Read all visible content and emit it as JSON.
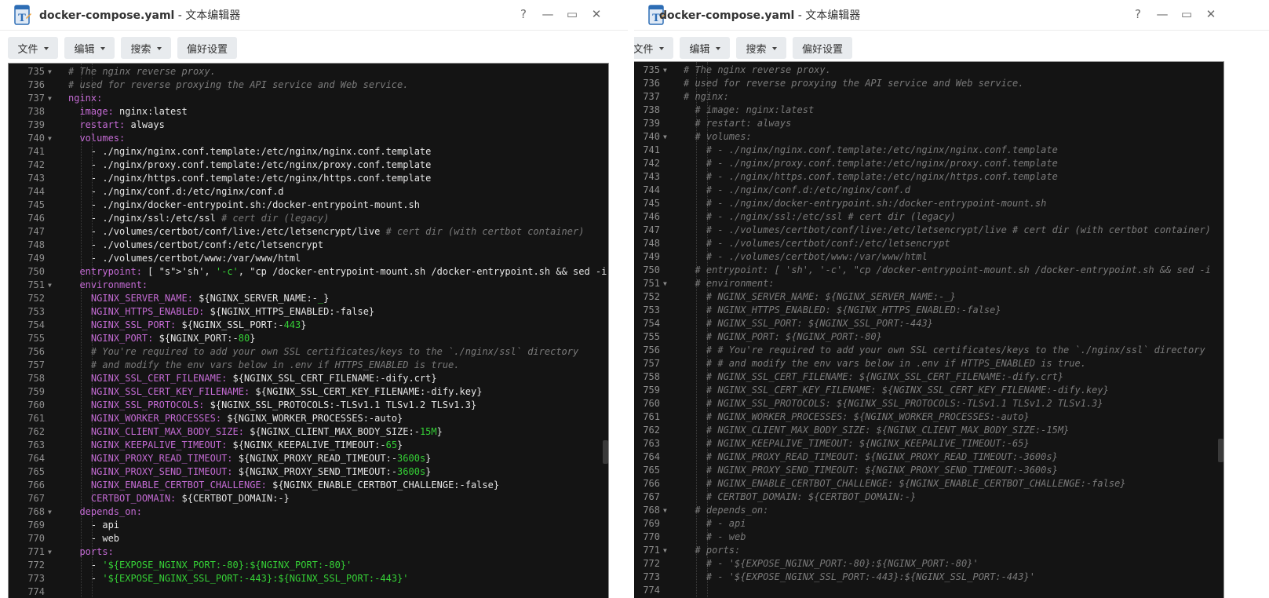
{
  "left": {
    "title": {
      "filename": "docker-compose.yaml",
      "suffix": " - 文本编辑器"
    },
    "menus": [
      {
        "label": "文件",
        "dropdown": true
      },
      {
        "label": "编辑",
        "dropdown": true
      },
      {
        "label": "搜索",
        "dropdown": true
      },
      {
        "label": "偏好设置",
        "dropdown": false
      }
    ],
    "lines": [
      {
        "n": "735",
        "fold": true,
        "t": "# The nginx reverse proxy."
      },
      {
        "n": "736",
        "t": "# used for reverse proxying the API service and Web service."
      },
      {
        "n": "737",
        "fold": true,
        "t": "nginx:"
      },
      {
        "n": "738",
        "t": "  image: nginx:latest"
      },
      {
        "n": "739",
        "t": "  restart: always"
      },
      {
        "n": "740",
        "fold": true,
        "t": "  volumes:"
      },
      {
        "n": "741",
        "t": "    - ./nginx/nginx.conf.template:/etc/nginx/nginx.conf.template"
      },
      {
        "n": "742",
        "t": "    - ./nginx/proxy.conf.template:/etc/nginx/proxy.conf.template"
      },
      {
        "n": "743",
        "t": "    - ./nginx/https.conf.template:/etc/nginx/https.conf.template"
      },
      {
        "n": "744",
        "t": "    - ./nginx/conf.d:/etc/nginx/conf.d"
      },
      {
        "n": "745",
        "t": "    - ./nginx/docker-entrypoint.sh:/docker-entrypoint-mount.sh"
      },
      {
        "n": "746",
        "t": "    - ./nginx/ssl:/etc/ssl # cert dir (legacy)"
      },
      {
        "n": "747",
        "t": "    - ./volumes/certbot/conf/live:/etc/letsencrypt/live # cert dir (with certbot container)"
      },
      {
        "n": "748",
        "t": "    - ./volumes/certbot/conf:/etc/letsencrypt"
      },
      {
        "n": "749",
        "t": "    - ./volumes/certbot/www:/var/www/html"
      },
      {
        "n": "750",
        "t": "  entrypoint: [ 'sh', '-c', \"cp /docker-entrypoint-mount.sh /docker-entrypoint.sh && sed -i"
      },
      {
        "n": "751",
        "fold": true,
        "t": "  environment:"
      },
      {
        "n": "752",
        "t": "    NGINX_SERVER_NAME: ${NGINX_SERVER_NAME:-_}"
      },
      {
        "n": "753",
        "t": "    NGINX_HTTPS_ENABLED: ${NGINX_HTTPS_ENABLED:-false}"
      },
      {
        "n": "754",
        "t": "    NGINX_SSL_PORT: ${NGINX_SSL_PORT:-443}"
      },
      {
        "n": "755",
        "t": "    NGINX_PORT: ${NGINX_PORT:-80}"
      },
      {
        "n": "756",
        "t": "    # You're required to add your own SSL certificates/keys to the `./nginx/ssl` directory"
      },
      {
        "n": "757",
        "t": "    # and modify the env vars below in .env if HTTPS_ENABLED is true."
      },
      {
        "n": "758",
        "t": "    NGINX_SSL_CERT_FILENAME: ${NGINX_SSL_CERT_FILENAME:-dify.crt}"
      },
      {
        "n": "759",
        "t": "    NGINX_SSL_CERT_KEY_FILENAME: ${NGINX_SSL_CERT_KEY_FILENAME:-dify.key}"
      },
      {
        "n": "760",
        "t": "    NGINX_SSL_PROTOCOLS: ${NGINX_SSL_PROTOCOLS:-TLSv1.1 TLSv1.2 TLSv1.3}"
      },
      {
        "n": "761",
        "t": "    NGINX_WORKER_PROCESSES: ${NGINX_WORKER_PROCESSES:-auto}"
      },
      {
        "n": "762",
        "t": "    NGINX_CLIENT_MAX_BODY_SIZE: ${NGINX_CLIENT_MAX_BODY_SIZE:-15M}"
      },
      {
        "n": "763",
        "t": "    NGINX_KEEPALIVE_TIMEOUT: ${NGINX_KEEPALIVE_TIMEOUT:-65}"
      },
      {
        "n": "764",
        "t": "    NGINX_PROXY_READ_TIMEOUT: ${NGINX_PROXY_READ_TIMEOUT:-3600s}"
      },
      {
        "n": "765",
        "t": "    NGINX_PROXY_SEND_TIMEOUT: ${NGINX_PROXY_SEND_TIMEOUT:-3600s}"
      },
      {
        "n": "766",
        "t": "    NGINX_ENABLE_CERTBOT_CHALLENGE: ${NGINX_ENABLE_CERTBOT_CHALLENGE:-false}"
      },
      {
        "n": "767",
        "t": "    CERTBOT_DOMAIN: ${CERTBOT_DOMAIN:-}"
      },
      {
        "n": "768",
        "fold": true,
        "t": "  depends_on:"
      },
      {
        "n": "769",
        "t": "    - api"
      },
      {
        "n": "770",
        "t": "    - web"
      },
      {
        "n": "771",
        "fold": true,
        "t": "  ports:"
      },
      {
        "n": "772",
        "t": "    - '${EXPOSE_NGINX_PORT:-80}:${NGINX_PORT:-80}'"
      },
      {
        "n": "773",
        "t": "    - '${EXPOSE_NGINX_SSL_PORT:-443}:${NGINX_SSL_PORT:-443}'"
      },
      {
        "n": "774",
        "t": ""
      }
    ]
  },
  "right": {
    "title": {
      "filename": "docker-compose.yaml",
      "suffix": " - 文本编辑器"
    },
    "menus": [
      {
        "label": "文件",
        "dropdown": true
      },
      {
        "label": "编辑",
        "dropdown": true
      },
      {
        "label": "搜索",
        "dropdown": true
      },
      {
        "label": "偏好设置",
        "dropdown": false
      }
    ],
    "lines": [
      {
        "n": "735",
        "fold": true,
        "t": "# The nginx reverse proxy."
      },
      {
        "n": "736",
        "t": "# used for reverse proxying the API service and Web service."
      },
      {
        "n": "737",
        "t": "# nginx:"
      },
      {
        "n": "738",
        "t": "  # image: nginx:latest"
      },
      {
        "n": "739",
        "t": "  # restart: always"
      },
      {
        "n": "740",
        "fold": true,
        "t": "  # volumes:"
      },
      {
        "n": "741",
        "t": "    # - ./nginx/nginx.conf.template:/etc/nginx/nginx.conf.template"
      },
      {
        "n": "742",
        "t": "    # - ./nginx/proxy.conf.template:/etc/nginx/proxy.conf.template"
      },
      {
        "n": "743",
        "t": "    # - ./nginx/https.conf.template:/etc/nginx/https.conf.template"
      },
      {
        "n": "744",
        "t": "    # - ./nginx/conf.d:/etc/nginx/conf.d"
      },
      {
        "n": "745",
        "t": "    # - ./nginx/docker-entrypoint.sh:/docker-entrypoint-mount.sh"
      },
      {
        "n": "746",
        "t": "    # - ./nginx/ssl:/etc/ssl # cert dir (legacy)"
      },
      {
        "n": "747",
        "t": "    # - ./volumes/certbot/conf/live:/etc/letsencrypt/live # cert dir (with certbot container)"
      },
      {
        "n": "748",
        "t": "    # - ./volumes/certbot/conf:/etc/letsencrypt"
      },
      {
        "n": "749",
        "t": "    # - ./volumes/certbot/www:/var/www/html"
      },
      {
        "n": "750",
        "t": "  # entrypoint: [ 'sh', '-c', \"cp /docker-entrypoint-mount.sh /docker-entrypoint.sh && sed -i"
      },
      {
        "n": "751",
        "fold": true,
        "t": "  # environment:"
      },
      {
        "n": "752",
        "t": "    # NGINX_SERVER_NAME: ${NGINX_SERVER_NAME:-_}"
      },
      {
        "n": "753",
        "t": "    # NGINX_HTTPS_ENABLED: ${NGINX_HTTPS_ENABLED:-false}"
      },
      {
        "n": "754",
        "t": "    # NGINX_SSL_PORT: ${NGINX_SSL_PORT:-443}"
      },
      {
        "n": "755",
        "t": "    # NGINX_PORT: ${NGINX_PORT:-80}"
      },
      {
        "n": "756",
        "t": "    # # You're required to add your own SSL certificates/keys to the `./nginx/ssl` directory"
      },
      {
        "n": "757",
        "t": "    # # and modify the env vars below in .env if HTTPS_ENABLED is true."
      },
      {
        "n": "758",
        "t": "    # NGINX_SSL_CERT_FILENAME: ${NGINX_SSL_CERT_FILENAME:-dify.crt}"
      },
      {
        "n": "759",
        "t": "    # NGINX_SSL_CERT_KEY_FILENAME: ${NGINX_SSL_CERT_KEY_FILENAME:-dify.key}"
      },
      {
        "n": "760",
        "t": "    # NGINX_SSL_PROTOCOLS: ${NGINX_SSL_PROTOCOLS:-TLSv1.1 TLSv1.2 TLSv1.3}"
      },
      {
        "n": "761",
        "t": "    # NGINX_WORKER_PROCESSES: ${NGINX_WORKER_PROCESSES:-auto}"
      },
      {
        "n": "762",
        "t": "    # NGINX_CLIENT_MAX_BODY_SIZE: ${NGINX_CLIENT_MAX_BODY_SIZE:-15M}"
      },
      {
        "n": "763",
        "t": "    # NGINX_KEEPALIVE_TIMEOUT: ${NGINX_KEEPALIVE_TIMEOUT:-65}"
      },
      {
        "n": "764",
        "t": "    # NGINX_PROXY_READ_TIMEOUT: ${NGINX_PROXY_READ_TIMEOUT:-3600s}"
      },
      {
        "n": "765",
        "t": "    # NGINX_PROXY_SEND_TIMEOUT: ${NGINX_PROXY_SEND_TIMEOUT:-3600s}"
      },
      {
        "n": "766",
        "t": "    # NGINX_ENABLE_CERTBOT_CHALLENGE: ${NGINX_ENABLE_CERTBOT_CHALLENGE:-false}"
      },
      {
        "n": "767",
        "t": "    # CERTBOT_DOMAIN: ${CERTBOT_DOMAIN:-}"
      },
      {
        "n": "768",
        "fold": true,
        "t": "  # depends_on:"
      },
      {
        "n": "769",
        "t": "    # - api"
      },
      {
        "n": "770",
        "t": "    # - web"
      },
      {
        "n": "771",
        "fold": true,
        "t": "  # ports:"
      },
      {
        "n": "772",
        "t": "    # - '${EXPOSE_NGINX_PORT:-80}:${NGINX_PORT:-80}'"
      },
      {
        "n": "773",
        "t": "    # - '${EXPOSE_NGINX_SSL_PORT:-443}:${NGINX_SSL_PORT:-443}'"
      },
      {
        "n": "774",
        "t": ""
      }
    ]
  },
  "window_controls": {
    "help": "?",
    "minimize": "—",
    "maximize": "▭",
    "close": "✕"
  },
  "colors": {
    "editor_bg": "#141414",
    "key": "#c46bd4",
    "string": "#35d136",
    "comment": "#7a7a7a",
    "text": "#e6e6e6",
    "line_number": "#8e8e8e"
  },
  "icons": {
    "app": "text-editor-app-icon",
    "help": "help-icon",
    "minimize": "minimize-icon",
    "maximize": "maximize-icon",
    "close": "close-icon",
    "fold": "fold-arrow-icon",
    "dropdown": "chevron-down-icon"
  }
}
